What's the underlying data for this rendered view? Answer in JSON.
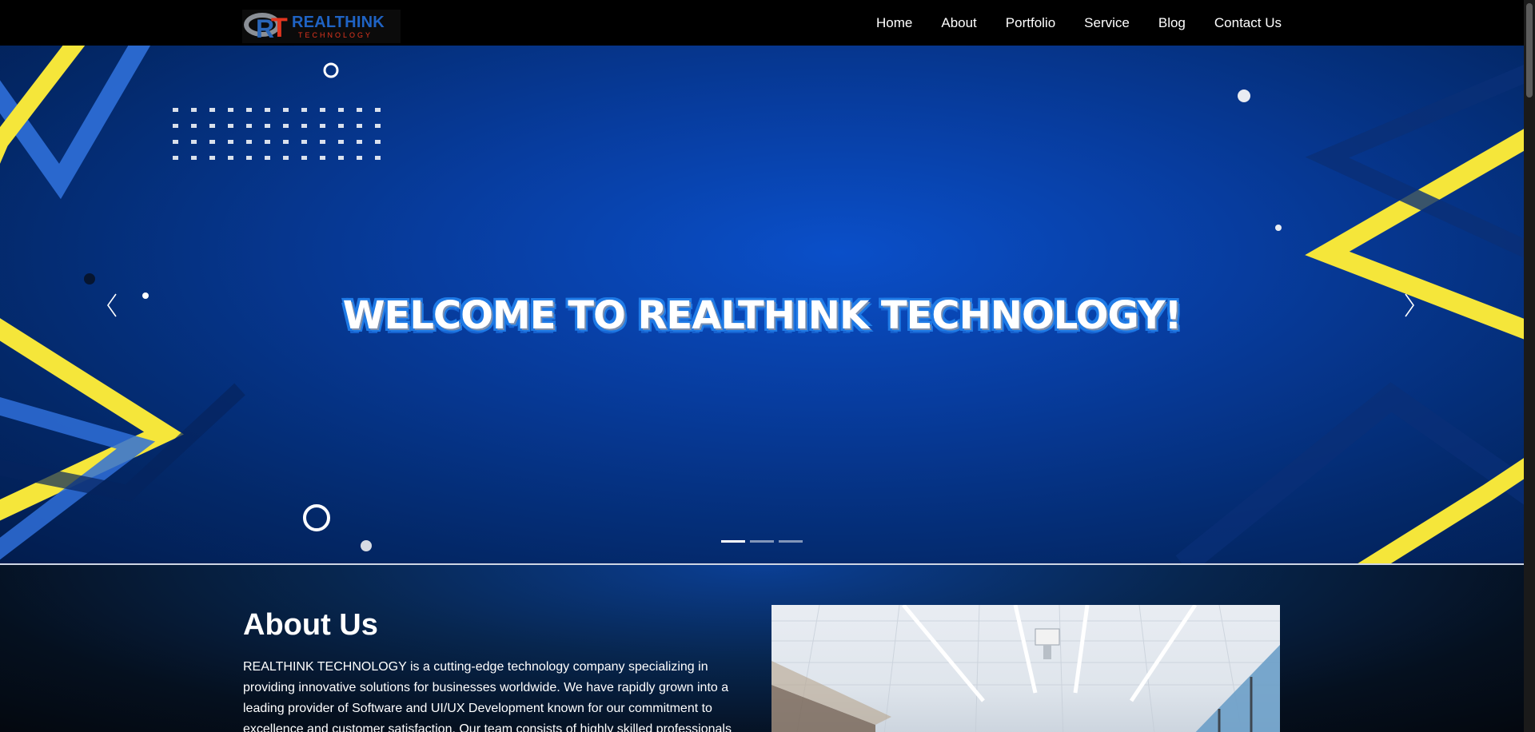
{
  "navbar": {
    "logo": {
      "mark_r": "R",
      "mark_t": "T",
      "name": "REALTHINK",
      "tagline": "TECHNOLOGY"
    },
    "links": [
      "Home",
      "About",
      "Portfolio",
      "Service",
      "Blog",
      "Contact Us"
    ]
  },
  "hero": {
    "title": "WELCOME TO REALTHINK TECHNOLOGY!",
    "slide_count": 3,
    "active_slide": 1,
    "colors": {
      "background": "#0747b0",
      "accent_yellow": "#f5e63a",
      "accent_blue": "#2f6fd8"
    }
  },
  "about": {
    "title": "About Us",
    "text": "REALTHINK TECHNOLOGY is a cutting-edge technology company specializing in providing innovative solutions for businesses worldwide. We have rapidly grown into a leading provider of Software and UI/UX Development known for our commitment to excellence and customer satisfaction. Our team consists of highly skilled professionals"
  }
}
